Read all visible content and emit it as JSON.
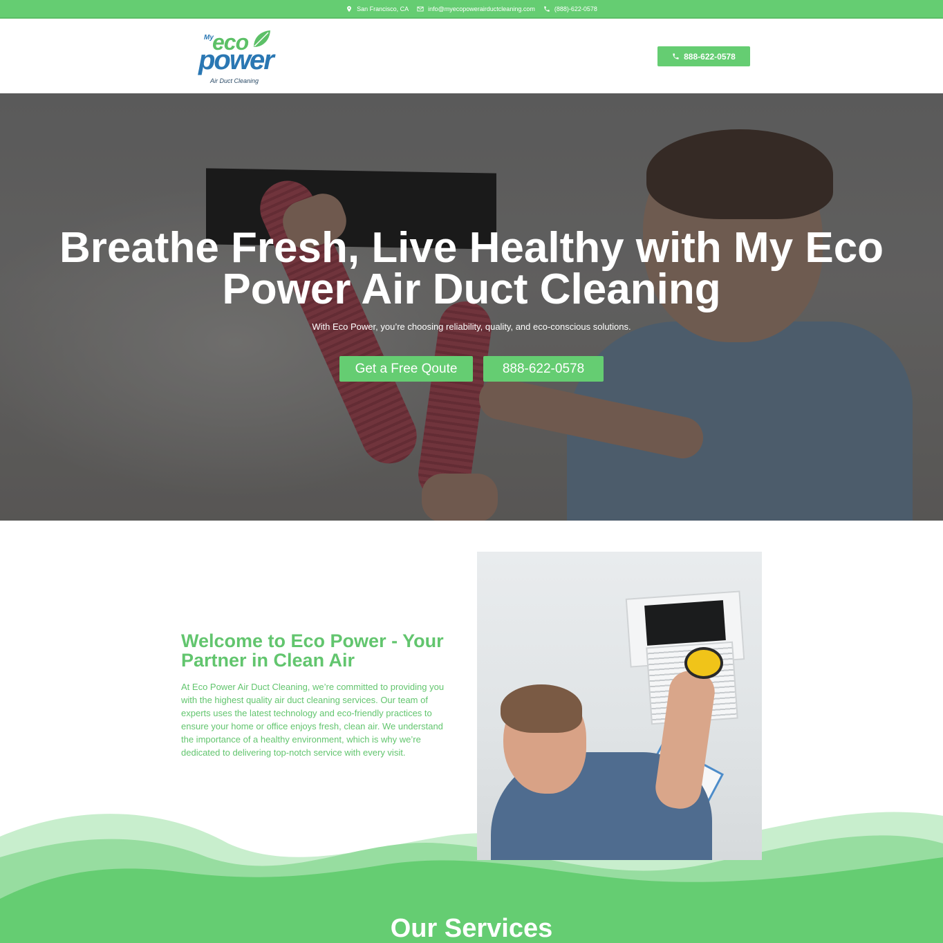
{
  "topbar": {
    "location": "San Francisco, CA",
    "email": "info@myecopowerairductcleaning.com",
    "phone": "(888)-622-0578"
  },
  "header": {
    "logo": {
      "my": "My",
      "eco": "eco",
      "power": "power",
      "tagline": "Air Duct Cleaning"
    },
    "phone_button": "888-622-0578"
  },
  "hero": {
    "title": "Breathe Fresh, Live Healthy with My Eco Power Air Duct Cleaning",
    "subtitle": "With Eco Power, you’re choosing reliability, quality, and eco-conscious solutions.",
    "quote_button": "Get a Free Qoute",
    "phone_button": "888-622-0578"
  },
  "welcome": {
    "title": "Welcome to Eco Power - Your Partner in Clean Air",
    "body": "At Eco Power Air Duct Cleaning, we’re committed to providing you with the highest quality air duct cleaning services. Our team of experts uses the latest technology and eco-friendly practices to ensure your home or office enjoys fresh, clean air. We understand the importance of a healthy environment, which is why we’re dedicated to delivering top-notch service with every visit."
  },
  "services": {
    "title": "Our Services"
  },
  "colors": {
    "accent": "#65cd72",
    "brand_blue": "#2a77b3",
    "white": "#ffffff"
  },
  "icons": {
    "location": "map-pin-icon",
    "email": "envelope-icon",
    "phone": "phone-icon"
  }
}
